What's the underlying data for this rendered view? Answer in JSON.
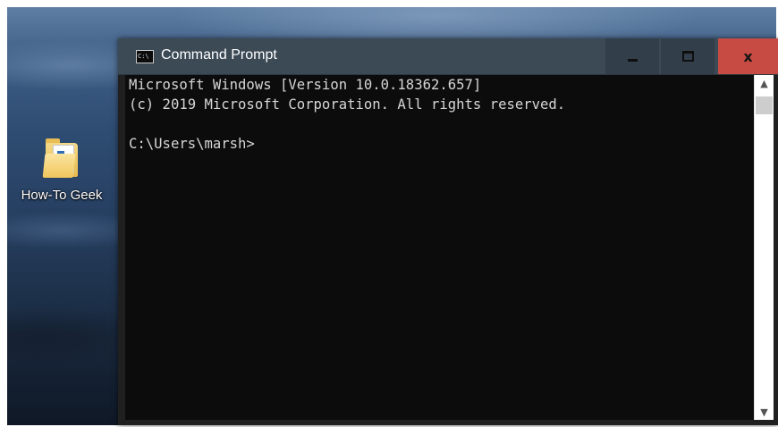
{
  "desktop": {
    "icons": [
      {
        "label": "How-To Geek",
        "icon": "folder-icon"
      }
    ]
  },
  "window": {
    "title": "Command Prompt",
    "app_icon": "console-icon",
    "app_icon_text": "C:\\",
    "controls": {
      "minimize": "minimize-icon",
      "maximize": "maximize-icon",
      "close_glyph": "x"
    },
    "colors": {
      "titlebar": "#3c4a56",
      "close_button": "#c84b43",
      "console_background": "#0c0c0c",
      "console_text": "#d6d6d6"
    }
  },
  "console": {
    "lines": [
      "Microsoft Windows [Version 10.0.18362.657]",
      "(c) 2019 Microsoft Corporation. All rights reserved.",
      "",
      "C:\\Users\\marsh>"
    ]
  },
  "scrollbar": {
    "up_glyph": "^",
    "down_glyph": "v"
  }
}
